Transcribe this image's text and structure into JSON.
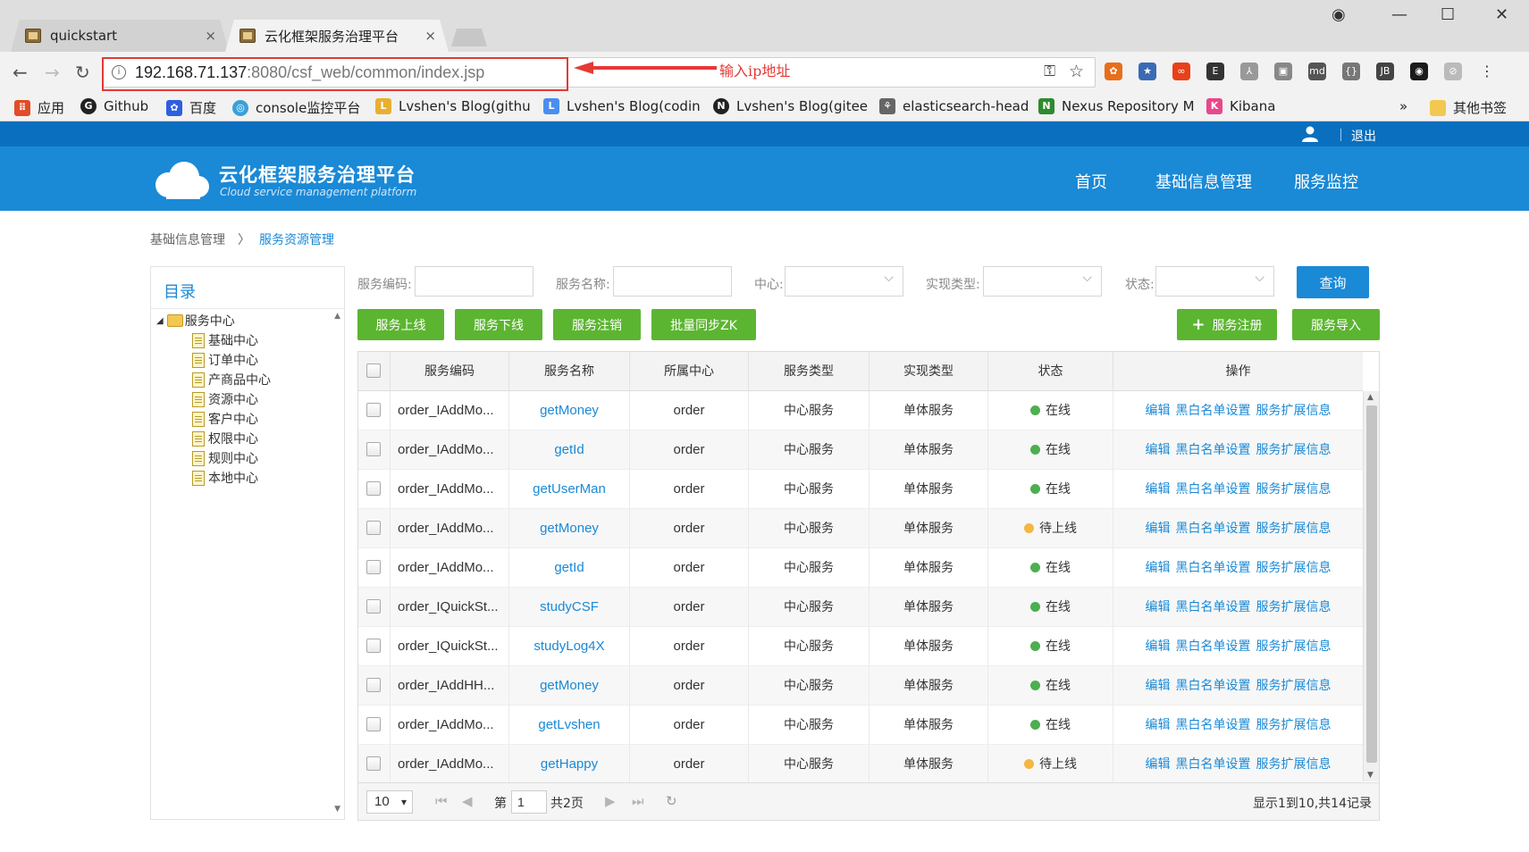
{
  "browser": {
    "tabs": [
      {
        "title": "quickstart",
        "close": "×"
      },
      {
        "title": "云化框架服务治理平台",
        "close": "×"
      }
    ],
    "url_host": "192.168.71.137",
    "url_rest": ":8080/csf_web/common/index.jsp",
    "annotation": "输入ip地址",
    "bookmarks": [
      {
        "label": "应用",
        "icon": "apps-grid-icon",
        "color": "#e34c26"
      },
      {
        "label": "Github",
        "icon": "github-icon",
        "color": "#222222"
      },
      {
        "label": "百度",
        "icon": "baidu-icon",
        "color": "#2f5fe0"
      },
      {
        "label": "console监控平台",
        "icon": "console-icon",
        "color": "#3aa1d8"
      },
      {
        "label": "Lvshen's Blog(githu",
        "icon": "blog-icon",
        "color": "#e8b02f"
      },
      {
        "label": "Lvshen's Blog(codin",
        "icon": "blog-icon",
        "color": "#4a8ef0"
      },
      {
        "label": "Lvshen's Blog(gitee",
        "icon": "blog-icon",
        "color": "#222222"
      },
      {
        "label": "elasticsearch-head",
        "icon": "es-icon",
        "color": "#666666"
      },
      {
        "label": "Nexus Repository M",
        "icon": "nexus-icon",
        "color": "#2e8b2e"
      },
      {
        "label": "Kibana",
        "icon": "kibana-icon",
        "color": "#e8478b"
      }
    ],
    "bookmarks_more": "»",
    "other_bookmarks": "其他书签"
  },
  "app": {
    "logout": "退出",
    "brand_title": "云化框架服务治理平台",
    "brand_sub": "Cloud service management platform",
    "nav": [
      "首页",
      "基础信息管理",
      "服务监控"
    ],
    "breadcrumb": [
      "基础信息管理",
      "服务资源管理"
    ],
    "breadcrumb_sep": "〉",
    "sidebar": {
      "title": "目录",
      "root": "服务中心",
      "children": [
        "基础中心",
        "订单中心",
        "产商品中心",
        "资源中心",
        "客户中心",
        "权限中心",
        "规则中心",
        "本地中心"
      ]
    },
    "filters": {
      "code_label": "服务编码:",
      "name_label": "服务名称:",
      "center_label": "中心:",
      "impl_label": "实现类型:",
      "status_label": "状态:",
      "query": "查询"
    },
    "actions": {
      "online": "服务上线",
      "offline": "服务下线",
      "cancel": "服务注销",
      "sync_zk": "批量同步ZK",
      "register": "服务注册",
      "import": "服务导入"
    },
    "grid": {
      "headers": [
        "服务编码",
        "服务名称",
        "所属中心",
        "服务类型",
        "实现类型",
        "状态",
        "操作"
      ],
      "rows": [
        {
          "code": "order_IAddMo...",
          "name": "getMoney",
          "center": "order",
          "type": "中心服务",
          "impl": "单体服务",
          "status": "在线",
          "status_color": "#4caf50"
        },
        {
          "code": "order_IAddMo...",
          "name": "getId",
          "center": "order",
          "type": "中心服务",
          "impl": "单体服务",
          "status": "在线",
          "status_color": "#4caf50"
        },
        {
          "code": "order_IAddMo...",
          "name": "getUserMan",
          "center": "order",
          "type": "中心服务",
          "impl": "单体服务",
          "status": "在线",
          "status_color": "#4caf50"
        },
        {
          "code": "order_IAddMo...",
          "name": "getMoney",
          "center": "order",
          "type": "中心服务",
          "impl": "单体服务",
          "status": "待上线",
          "status_color": "#f4b740"
        },
        {
          "code": "order_IAddMo...",
          "name": "getId",
          "center": "order",
          "type": "中心服务",
          "impl": "单体服务",
          "status": "在线",
          "status_color": "#4caf50"
        },
        {
          "code": "order_IQuickSt...",
          "name": "studyCSF",
          "center": "order",
          "type": "中心服务",
          "impl": "单体服务",
          "status": "在线",
          "status_color": "#4caf50"
        },
        {
          "code": "order_IQuickSt...",
          "name": "studyLog4X",
          "center": "order",
          "type": "中心服务",
          "impl": "单体服务",
          "status": "在线",
          "status_color": "#4caf50"
        },
        {
          "code": "order_IAddHH...",
          "name": "getMoney",
          "center": "order",
          "type": "中心服务",
          "impl": "单体服务",
          "status": "在线",
          "status_color": "#4caf50"
        },
        {
          "code": "order_IAddMo...",
          "name": "getLvshen",
          "center": "order",
          "type": "中心服务",
          "impl": "单体服务",
          "status": "在线",
          "status_color": "#4caf50"
        },
        {
          "code": "order_IAddMo...",
          "name": "getHappy",
          "center": "order",
          "type": "中心服务",
          "impl": "单体服务",
          "status": "待上线",
          "status_color": "#f4b740"
        }
      ],
      "ops": [
        "编辑",
        "黑白名单设置",
        "服务扩展信息"
      ]
    },
    "pager": {
      "page_size": "10",
      "page_prefix": "第",
      "page": "1",
      "page_suffix": "共2页",
      "info": "显示1到10,共14记录"
    }
  }
}
